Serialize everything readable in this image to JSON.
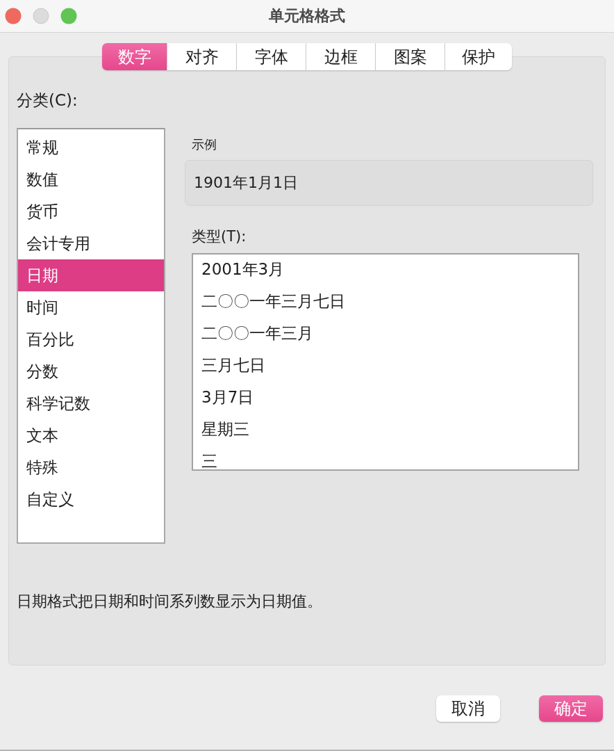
{
  "window": {
    "title": "单元格格式"
  },
  "tabs": [
    {
      "label": "数字",
      "selected": true
    },
    {
      "label": "对齐",
      "selected": false
    },
    {
      "label": "字体",
      "selected": false
    },
    {
      "label": "边框",
      "selected": false
    },
    {
      "label": "图案",
      "selected": false
    },
    {
      "label": "保护",
      "selected": false
    }
  ],
  "category": {
    "label": "分类(C):",
    "items": [
      {
        "label": "常规",
        "selected": false
      },
      {
        "label": "数值",
        "selected": false
      },
      {
        "label": "货币",
        "selected": false
      },
      {
        "label": "会计专用",
        "selected": false
      },
      {
        "label": "日期",
        "selected": true
      },
      {
        "label": "时间",
        "selected": false
      },
      {
        "label": "百分比",
        "selected": false
      },
      {
        "label": "分数",
        "selected": false
      },
      {
        "label": "科学记数",
        "selected": false
      },
      {
        "label": "文本",
        "selected": false
      },
      {
        "label": "特殊",
        "selected": false
      },
      {
        "label": "自定义",
        "selected": false
      }
    ]
  },
  "sample": {
    "label": "示例",
    "value": "1901年1月1日"
  },
  "type": {
    "label": "类型(T):",
    "items": [
      "2001年3月",
      "二〇〇一年三月七日",
      "二〇〇一年三月",
      "三月七日",
      "3月7日",
      "星期三",
      "三"
    ]
  },
  "description": "日期格式把日期和时间系列数显示为日期值。",
  "buttons": [
    {
      "label": "取消",
      "kind": "secondary"
    },
    {
      "label": "确定",
      "kind": "primary"
    }
  ]
}
